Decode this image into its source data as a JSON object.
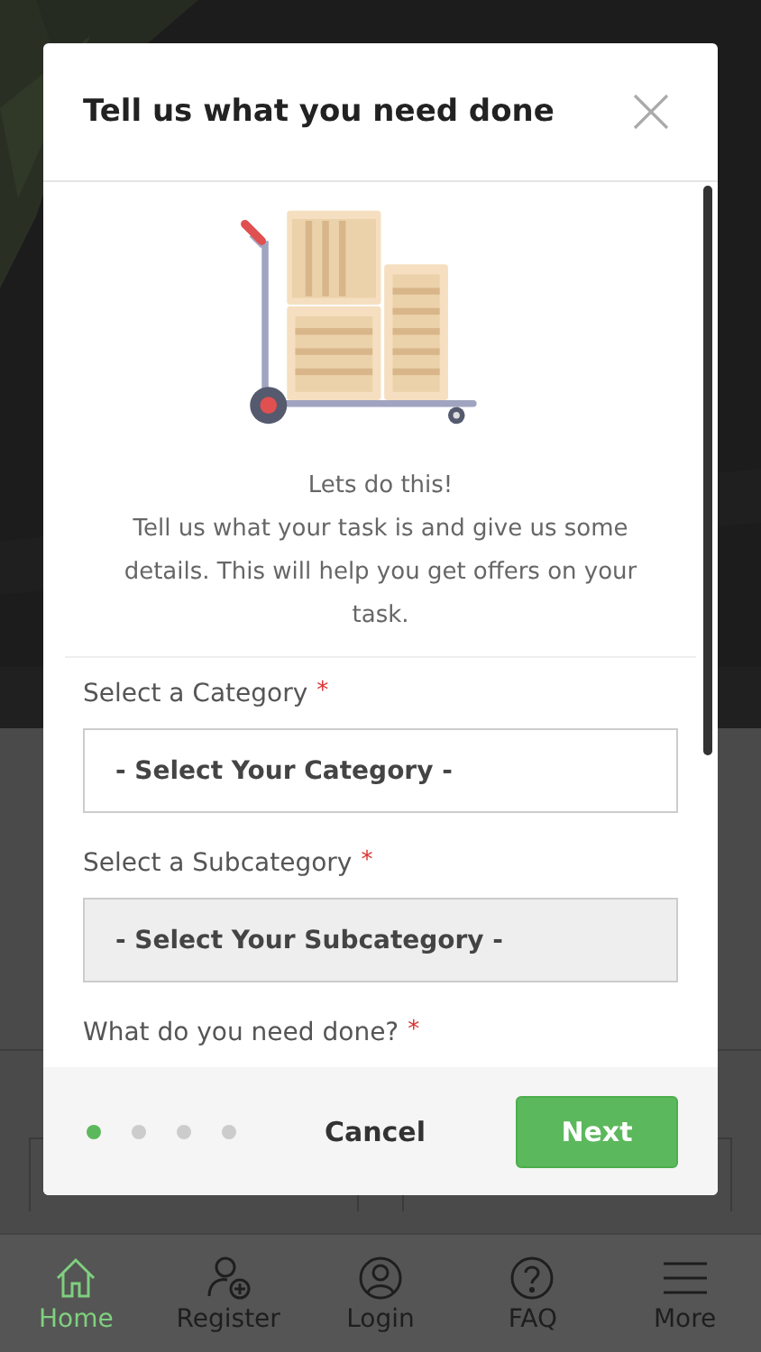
{
  "modal": {
    "title": "Tell us what you need done",
    "intro": [
      "Lets do this!",
      "Tell us what your task is and give us some details. This will help you get offers on your task."
    ],
    "fields": [
      {
        "label": "Select a Category",
        "required_mark": "*",
        "kind": "select",
        "value": "- Select Your Category -",
        "disabled": false
      },
      {
        "label": "Select a Subcategory",
        "required_mark": "*",
        "kind": "select",
        "value": "- Select Your Subcategory -",
        "disabled": true
      },
      {
        "label": "What do you need done?",
        "required_mark": "*",
        "kind": "text"
      }
    ],
    "steps": [
      {
        "selected": true
      },
      {
        "selected": false
      },
      {
        "selected": false
      },
      {
        "selected": false
      }
    ],
    "buttons": {
      "cancel": "Cancel",
      "next": "Next"
    }
  },
  "bottom_nav": [
    {
      "label": "Home",
      "selected": true
    },
    {
      "label": "Register",
      "selected": false
    },
    {
      "label": "Login",
      "selected": false
    },
    {
      "label": "FAQ",
      "selected": false
    },
    {
      "label": "More",
      "selected": false
    }
  ]
}
